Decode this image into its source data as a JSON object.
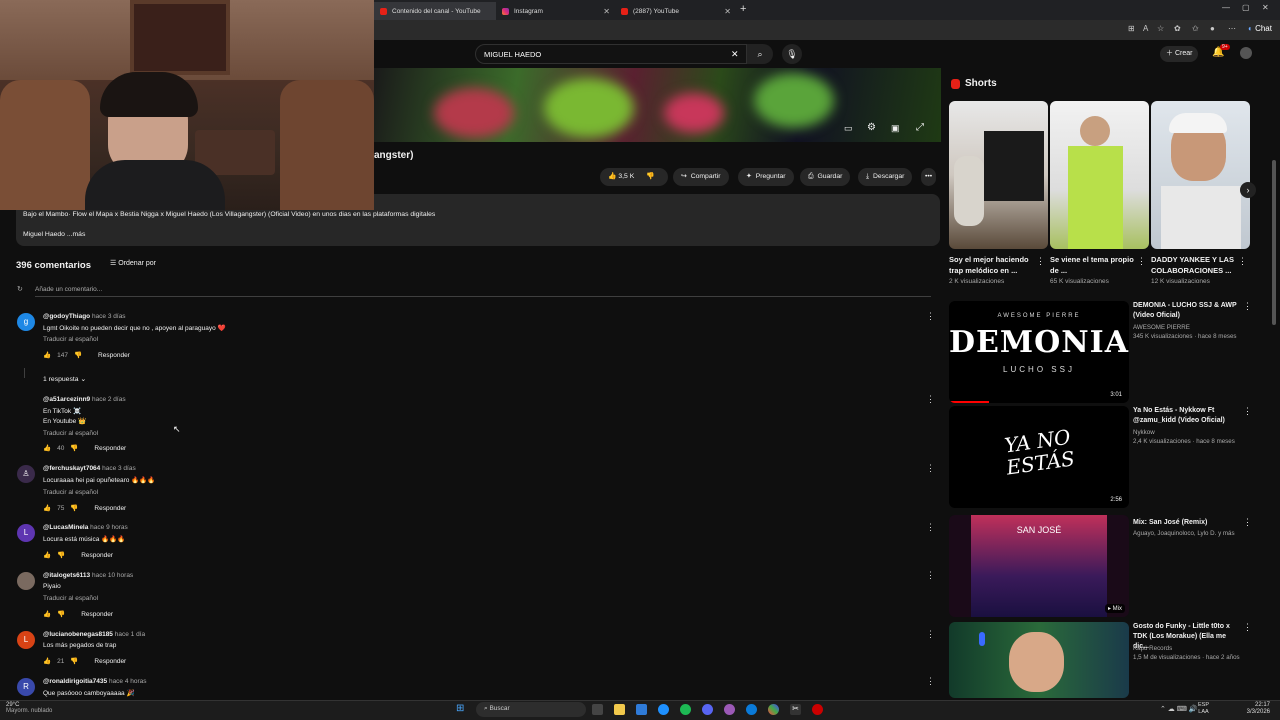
{
  "browser": {
    "tabs": [
      {
        "label": "Contenido del canal - YouTube Studio"
      },
      {
        "label": "Instagram"
      },
      {
        "label": "(2887) YouTube"
      }
    ],
    "new_tab": "+",
    "profile_label": "Chat"
  },
  "header": {
    "search_value": "MIGUEL HAEDO",
    "clear": "✕",
    "create_label": "Crear",
    "notif_count": "9+"
  },
  "video": {
    "title_partial": "angster)",
    "likes": "3,5 K",
    "share": "Compartir",
    "ask": "Preguntar",
    "save": "Guardar",
    "download": "Descargar",
    "description": "Bajo el Mambo· Flow el Mapa x Bestia Nigga x Miguel Haedo (Los Villagangster) (Oficial Video) en unos dias en las plataformas digitales",
    "desc_author": "Miguel Haedo",
    "desc_more": "...más"
  },
  "comments": {
    "count": "396 comentarios",
    "sort": "Ordenar por",
    "add_placeholder": "Añade un comentario...",
    "translate": "Traducir al español",
    "reply": "Responder",
    "items": [
      {
        "author": "@godoyThiago",
        "time": "hace 3 días",
        "text": "Lgmt Oikoite no pueden decir que no , apoyen al paraguayo ❤️",
        "likes": "147",
        "avatar": "g",
        "replies": "1 respuesta"
      },
      {
        "author": "@a51arcezinn9",
        "time": "hace 2 días",
        "text": "En TikTok ☠️",
        "text2": "En Youtube 👑",
        "likes": "40"
      },
      {
        "author": "@ferchuskayt7064",
        "time": "hace 3 días",
        "text": "Locuraaaa hei pai opuñetearo 🔥🔥🔥",
        "likes": "75"
      },
      {
        "author": "@LucasMinela",
        "time": "hace 9 horas",
        "text": "Locura está música 🔥🔥🔥",
        "likes": "",
        "avatar": "L"
      },
      {
        "author": "@italogets6113",
        "time": "hace 10 horas",
        "text": "Piyaio",
        "likes": ""
      },
      {
        "author": "@lucianobenegas8185",
        "time": "hace 1 día",
        "text": "Los más pegados de trap",
        "likes": "21",
        "avatar": "L"
      },
      {
        "author": "@ronaldirigoitia7435",
        "time": "hace 4 horas",
        "text": "Que pasóooo camboyaaaaa 🎉",
        "avatar": "R"
      }
    ]
  },
  "shorts": {
    "heading": "Shorts",
    "items": [
      {
        "title": "Soy el mejor haciendo trap melódico en ...",
        "views": "2 K visualizaciones"
      },
      {
        "title": "Se viene el tema propio de ...",
        "views": "65 K visualizaciones"
      },
      {
        "title": "DADDY YANKEE Y LAS COLABORACIONES ...",
        "views": "12 K visualizaciones"
      }
    ]
  },
  "recommended": [
    {
      "title": "DEMONIA - LUCHO SSJ & AWP (Video Oficial)",
      "channel": "AWESOME PIERRE",
      "stats": "345 K visualizaciones · hace 8 meses",
      "duration": "3:01",
      "thumb_text": "DEMONIA",
      "thumb_sub": "LUCHO SSJ",
      "thumb_top": "AWESOME PIERRE"
    },
    {
      "title": "Ya No Estás - Nykkow Ft @zamu_kidd (Video Oficial)",
      "channel": "Nykkow",
      "stats": "2,4 K visualizaciones · hace 8 meses",
      "duration": "2:56",
      "thumb_text": "YA NO ESTÁS"
    },
    {
      "title": "Mix: San José (Remix)",
      "channel": "Aguayo, Joaquinoloco, Lylo D. y más",
      "stats": "",
      "duration": "Mix",
      "thumb_text": "SAN JOSÉ"
    },
    {
      "title": "Gosto do Funky - Little t0to x TDK (Los Morakue) (Ella me dic...",
      "channel": "Kapú Records",
      "stats": "1,5 M de visualizaciones · hace 2 años",
      "duration": ""
    }
  ],
  "taskbar": {
    "weather_temp": "29°C",
    "weather_desc": "Mayorm. nublado",
    "search": "Buscar",
    "lang": "ESP",
    "lang2": "LAA",
    "time": "22:17",
    "date": "3/3/2026"
  }
}
